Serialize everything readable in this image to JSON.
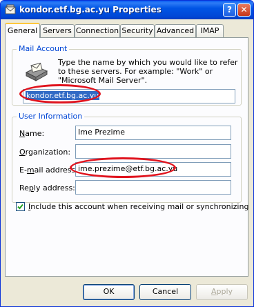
{
  "window": {
    "title": "kondor.etf.bg.ac.yu Properties",
    "help_glyph": "?",
    "close_glyph": "✕"
  },
  "tabs": [
    "General",
    "Servers",
    "Connection",
    "Security",
    "Advanced",
    "IMAP"
  ],
  "mail_account": {
    "group_label": "Mail Account",
    "description": "Type the name by which you would like to refer to these servers.  For example: \"Work\" or \"Microsoft Mail Server\".",
    "account_name": "kondor.etf.bg.ac.yu"
  },
  "user_info": {
    "group_label": "User Information",
    "name_label": "Name:",
    "name_value": "Ime Prezime",
    "org_label": "Organization:",
    "org_value": "",
    "email_label": "E-mail address:",
    "email_value": "ime.prezime@etf.bg.ac.yu",
    "reply_label": "Reply address:",
    "reply_value": ""
  },
  "include_checkbox": {
    "checked": true,
    "label": "Include this account when receiving mail or synchronizing"
  },
  "buttons": {
    "ok": "OK",
    "cancel": "Cancel",
    "apply": "Apply"
  },
  "colors": {
    "titlebar": "#0055E5",
    "group_label": "#0046D5",
    "annotation_oval": "#E0141E",
    "selection": "#316AC5"
  }
}
